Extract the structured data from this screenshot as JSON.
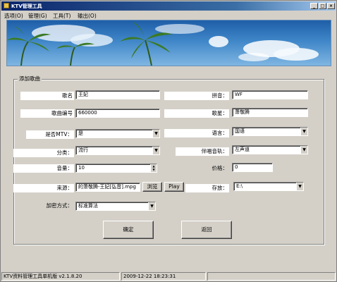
{
  "window": {
    "title": "KTV管理工具"
  },
  "menu": [
    "选项(O)",
    "管理(G)",
    "工具(T)",
    "输出(O)"
  ],
  "form": {
    "group_title": "添加歌曲",
    "song_name": {
      "label": "歌名",
      "value": "王妃"
    },
    "pinyin": {
      "label": "拼音：",
      "value": "WF"
    },
    "song_no": {
      "label": "歌曲编号",
      "value": "660000"
    },
    "singer": {
      "label": "歌星：",
      "value": "萧敬腾"
    },
    "is_mtv": {
      "label": "是否MTV：",
      "value": "是"
    },
    "language": {
      "label": "语言：",
      "value": "国语"
    },
    "category": {
      "label": "分类：",
      "value": "流行"
    },
    "accompany": {
      "label": "伴唱音轨：",
      "value": "左声道"
    },
    "volume": {
      "label": "音量：",
      "value": "10"
    },
    "price": {
      "label": "价格：",
      "value": "0"
    },
    "source": {
      "label": "来源：",
      "value": "的萧敬腾-王妃[弘音].mpg"
    },
    "storage": {
      "label": "存放：",
      "value": "E:\\"
    },
    "encrypt": {
      "label": "加密方式：",
      "value": "标准算法"
    },
    "browse_btn": "浏览",
    "play_btn": "Play",
    "ok_btn": "确定",
    "back_btn": "返回"
  },
  "status": {
    "left": "KTV资料管理工具单机版  v2.1.8.20",
    "datetime": "2009-12-22 18:23:31"
  }
}
